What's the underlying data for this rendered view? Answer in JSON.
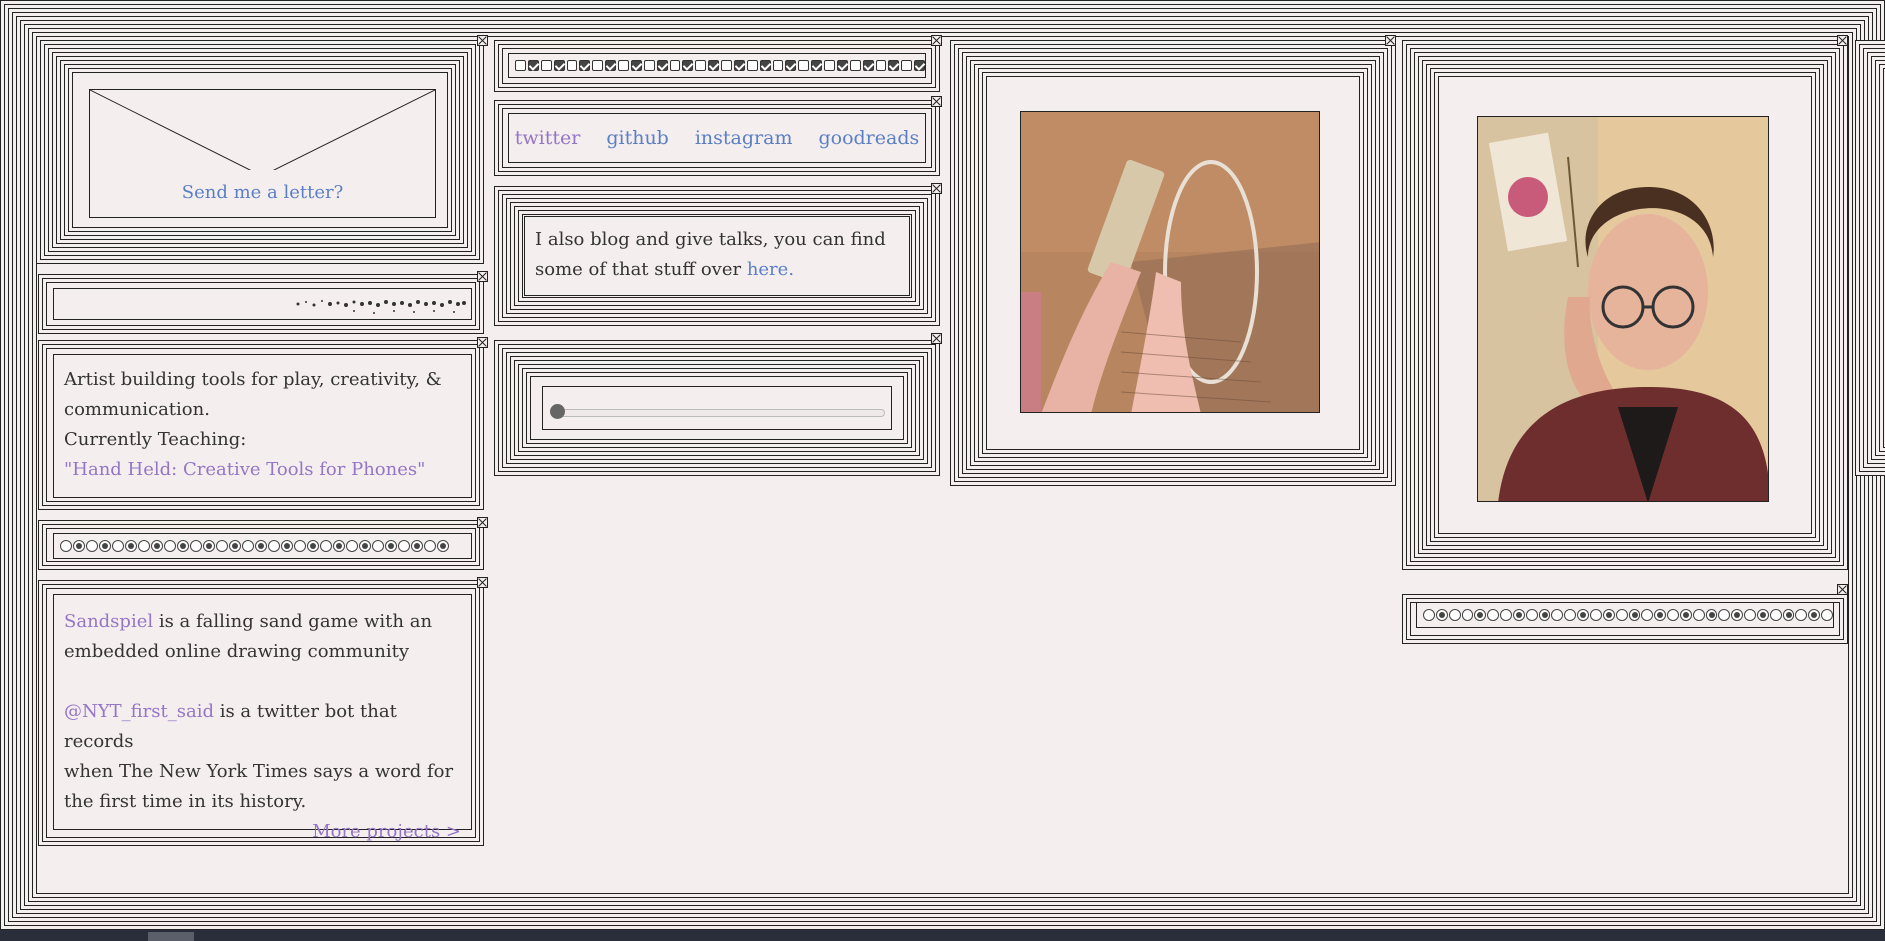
{
  "colors": {
    "background": "#f4eeee",
    "border": "#222222",
    "link_blue": "#5b7fc4",
    "link_purple": "#9575c6"
  },
  "letter": {
    "label": "Send me a letter?"
  },
  "about": {
    "line1": "Artist building tools for play, creativity, &",
    "line2": "communication.",
    "teaching_label": "Currently Teaching:",
    "teaching_course": "\"Hand Held: Creative Tools for Phones\""
  },
  "projects": {
    "p1_link": "Sandspiel",
    "p1_text_a": " is a falling sand game with an",
    "p1_text_b": "embedded online drawing community",
    "p2_link": "@NYT_first_said",
    "p2_text_a": " is a twitter bot that records",
    "p2_text_b": "when The New York Times says a word for",
    "p2_text_c": "the first time in its history.",
    "more": "More projects >"
  },
  "social": {
    "links": [
      "twitter",
      "github",
      "instagram",
      "goodreads"
    ]
  },
  "blog": {
    "line1": "I also blog and give talks, you can find",
    "line2": "some of that stuff over ",
    "link": "here."
  },
  "slider": {
    "value": 0
  },
  "checkbox_row": {
    "pattern": [
      0,
      1,
      0,
      1,
      0,
      1,
      0,
      1,
      0,
      1,
      0,
      1,
      0,
      1,
      0,
      1,
      0,
      1,
      0,
      1,
      0,
      1,
      0,
      1,
      0,
      1,
      0,
      1,
      0,
      1,
      0,
      1
    ]
  },
  "radio_row_left": {
    "pattern": [
      0,
      1,
      0,
      1,
      0,
      1,
      0,
      1,
      0,
      1,
      0,
      1,
      0,
      1,
      0,
      1,
      0,
      1,
      0,
      1,
      0,
      1,
      0,
      1,
      0,
      1,
      0,
      1,
      0,
      1
    ]
  },
  "radio_row_right": {
    "pattern": [
      0,
      1,
      0,
      0,
      1,
      0,
      0,
      1,
      0,
      1,
      0,
      0,
      1,
      0,
      1,
      0,
      1,
      0,
      1,
      0,
      1,
      0,
      1,
      0,
      1,
      0,
      1,
      0,
      1,
      0,
      1,
      0
    ]
  },
  "icons": {
    "close": "close-icon",
    "envelope": "envelope-icon",
    "photo_hands": "hands-power-strip-photo",
    "photo_portrait": "portrait-photo"
  }
}
